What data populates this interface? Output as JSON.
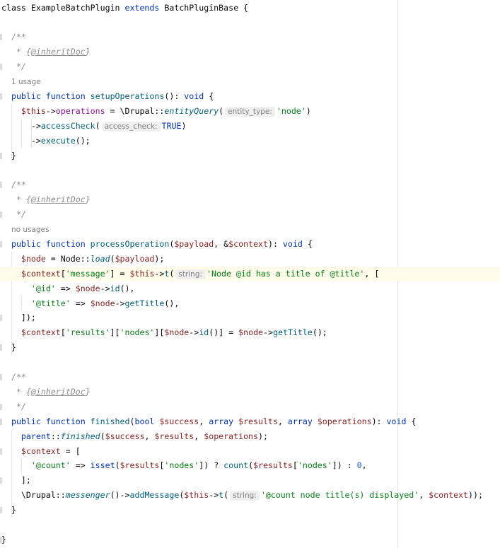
{
  "editor": {
    "lines": [
      [
        [
          "plain",
          "class "
        ],
        [
          "plain",
          "ExampleBatchPlugin "
        ],
        [
          "kw",
          "extends "
        ],
        [
          "plain",
          "BatchPluginBase {"
        ]
      ],
      [],
      [
        [
          "plain",
          "  "
        ],
        [
          "cmt",
          "/**"
        ]
      ],
      [
        [
          "plain",
          "   "
        ],
        [
          "cmt",
          "* {"
        ],
        [
          "doc",
          "@inheritDoc"
        ],
        [
          "cmt",
          "}"
        ]
      ],
      [
        [
          "plain",
          "   "
        ],
        [
          "cmt",
          "*/"
        ]
      ],
      [
        [
          "plain",
          "  "
        ],
        [
          "usage",
          "1 usage"
        ]
      ],
      [
        [
          "plain",
          "  "
        ],
        [
          "kw",
          "public function "
        ],
        [
          "fn",
          "setupOperations"
        ],
        [
          "plain",
          "(): "
        ],
        [
          "kw",
          "void "
        ],
        [
          "plain",
          "{"
        ]
      ],
      [
        [
          "plain",
          "    "
        ],
        [
          "var",
          "$this"
        ],
        [
          "plain",
          "->"
        ],
        [
          "field",
          "operations"
        ],
        [
          "plain",
          " = \\Drupal::"
        ],
        [
          "fni",
          "entityQuery"
        ],
        [
          "plain",
          "("
        ],
        [
          "hint",
          "entity_type:"
        ],
        [
          "str",
          "'node'"
        ],
        [
          "plain",
          ")"
        ]
      ],
      [
        [
          "plain",
          "      ->"
        ],
        [
          "fn",
          "accessCheck"
        ],
        [
          "plain",
          "("
        ],
        [
          "hint",
          "access_check:"
        ],
        [
          "kw",
          "TRUE"
        ],
        [
          "plain",
          ")"
        ]
      ],
      [
        [
          "plain",
          "      ->"
        ],
        [
          "fn",
          "execute"
        ],
        [
          "plain",
          "();"
        ]
      ],
      [
        [
          "plain",
          "  }"
        ]
      ],
      [],
      [
        [
          "plain",
          "  "
        ],
        [
          "cmt",
          "/**"
        ]
      ],
      [
        [
          "plain",
          "   "
        ],
        [
          "cmt",
          "* {"
        ],
        [
          "doc",
          "@inheritDoc"
        ],
        [
          "cmt",
          "}"
        ]
      ],
      [
        [
          "plain",
          "   "
        ],
        [
          "cmt",
          "*/"
        ]
      ],
      [
        [
          "plain",
          "  "
        ],
        [
          "usage",
          "no usages"
        ]
      ],
      [
        [
          "plain",
          "  "
        ],
        [
          "kw",
          "public function "
        ],
        [
          "fn",
          "processOperation"
        ],
        [
          "plain",
          "("
        ],
        [
          "var",
          "$payload"
        ],
        [
          "plain",
          ", &"
        ],
        [
          "var",
          "$context"
        ],
        [
          "plain",
          "): "
        ],
        [
          "kw",
          "void "
        ],
        [
          "plain",
          "{"
        ]
      ],
      [
        [
          "plain",
          "    "
        ],
        [
          "var",
          "$node"
        ],
        [
          "plain",
          " = Node::"
        ],
        [
          "fni",
          "load"
        ],
        [
          "plain",
          "("
        ],
        [
          "var",
          "$payload"
        ],
        [
          "plain",
          ");"
        ]
      ],
      [
        [
          "plain",
          "    "
        ],
        [
          "var",
          "$context"
        ],
        [
          "plain",
          "["
        ],
        [
          "str",
          "'message'"
        ],
        [
          "plain",
          "] = "
        ],
        [
          "var",
          "$this"
        ],
        [
          "plain",
          "->"
        ],
        [
          "fn",
          "t"
        ],
        [
          "plain",
          "("
        ],
        [
          "hint",
          "string:"
        ],
        [
          "str",
          "'Node @id has a title of @title'"
        ],
        [
          "plain",
          ", ["
        ]
      ],
      [
        [
          "plain",
          "      "
        ],
        [
          "str",
          "'@id'"
        ],
        [
          "plain",
          " => "
        ],
        [
          "var",
          "$node"
        ],
        [
          "plain",
          "->"
        ],
        [
          "fn",
          "id"
        ],
        [
          "plain",
          "(),"
        ]
      ],
      [
        [
          "plain",
          "      "
        ],
        [
          "str",
          "'@title'"
        ],
        [
          "plain",
          " => "
        ],
        [
          "var",
          "$node"
        ],
        [
          "plain",
          "->"
        ],
        [
          "fn",
          "getTitle"
        ],
        [
          "plain",
          "(),"
        ]
      ],
      [
        [
          "plain",
          "    ]);"
        ]
      ],
      [
        [
          "plain",
          "    "
        ],
        [
          "var",
          "$context"
        ],
        [
          "plain",
          "["
        ],
        [
          "str",
          "'results'"
        ],
        [
          "plain",
          "]["
        ],
        [
          "str",
          "'nodes'"
        ],
        [
          "plain",
          "]["
        ],
        [
          "var",
          "$node"
        ],
        [
          "plain",
          "->"
        ],
        [
          "fn",
          "id"
        ],
        [
          "plain",
          "()] = "
        ],
        [
          "var",
          "$node"
        ],
        [
          "plain",
          "->"
        ],
        [
          "fn",
          "getTitle"
        ],
        [
          "plain",
          "();"
        ]
      ],
      [
        [
          "plain",
          "  }"
        ]
      ],
      [],
      [
        [
          "plain",
          "  "
        ],
        [
          "cmt",
          "/**"
        ]
      ],
      [
        [
          "plain",
          "   "
        ],
        [
          "cmt",
          "* {"
        ],
        [
          "doc",
          "@inheritDoc"
        ],
        [
          "cmt",
          "}"
        ]
      ],
      [
        [
          "plain",
          "   "
        ],
        [
          "cmt",
          "*/"
        ]
      ],
      [
        [
          "plain",
          "  "
        ],
        [
          "kw",
          "public function "
        ],
        [
          "fn",
          "finished"
        ],
        [
          "plain",
          "("
        ],
        [
          "kw",
          "bool "
        ],
        [
          "var",
          "$success"
        ],
        [
          "plain",
          ", "
        ],
        [
          "kw",
          "array "
        ],
        [
          "var",
          "$results"
        ],
        [
          "plain",
          ", "
        ],
        [
          "kw",
          "array "
        ],
        [
          "var",
          "$operations"
        ],
        [
          "plain",
          "): "
        ],
        [
          "kw",
          "void "
        ],
        [
          "plain",
          "{"
        ]
      ],
      [
        [
          "plain",
          "    "
        ],
        [
          "kw",
          "parent"
        ],
        [
          "plain",
          "::"
        ],
        [
          "fni",
          "finished"
        ],
        [
          "plain",
          "("
        ],
        [
          "var",
          "$success"
        ],
        [
          "plain",
          ", "
        ],
        [
          "var",
          "$results"
        ],
        [
          "plain",
          ", "
        ],
        [
          "var",
          "$operations"
        ],
        [
          "plain",
          ");"
        ]
      ],
      [
        [
          "plain",
          "    "
        ],
        [
          "var",
          "$context"
        ],
        [
          "plain",
          " = ["
        ]
      ],
      [
        [
          "plain",
          "      "
        ],
        [
          "str",
          "'@count'"
        ],
        [
          "plain",
          " => "
        ],
        [
          "kw",
          "isset"
        ],
        [
          "plain",
          "("
        ],
        [
          "var",
          "$results"
        ],
        [
          "plain",
          "["
        ],
        [
          "str",
          "'nodes'"
        ],
        [
          "plain",
          "]) ? "
        ],
        [
          "fn",
          "count"
        ],
        [
          "plain",
          "("
        ],
        [
          "var",
          "$results"
        ],
        [
          "plain",
          "["
        ],
        [
          "str",
          "'nodes'"
        ],
        [
          "plain",
          "]) : "
        ],
        [
          "num",
          "0"
        ],
        [
          "plain",
          ","
        ]
      ],
      [
        [
          "plain",
          "    ];"
        ]
      ],
      [
        [
          "plain",
          "    \\Drupal::"
        ],
        [
          "fni",
          "messenger"
        ],
        [
          "plain",
          "()->"
        ],
        [
          "fn",
          "addMessage"
        ],
        [
          "plain",
          "("
        ],
        [
          "var",
          "$this"
        ],
        [
          "plain",
          "->"
        ],
        [
          "fn",
          "t"
        ],
        [
          "plain",
          "("
        ],
        [
          "hint",
          "string:"
        ],
        [
          "str",
          "'@count node title(s) displayed'"
        ],
        [
          "plain",
          ", "
        ],
        [
          "var",
          "$context"
        ],
        [
          "plain",
          "));"
        ]
      ],
      [
        [
          "plain",
          "  }"
        ]
      ],
      [],
      [
        [
          "plain",
          "}"
        ]
      ]
    ],
    "highlighted_line": 18
  }
}
